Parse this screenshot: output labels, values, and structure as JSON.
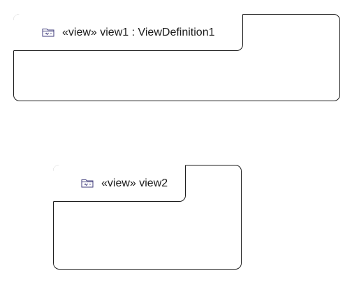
{
  "diagram": {
    "nodes": [
      {
        "id": "view1",
        "icon": "view-icon",
        "label": "«view» view1 : ViewDefinition1"
      },
      {
        "id": "view2",
        "icon": "view-icon",
        "label": "«view» view2"
      }
    ],
    "colors": {
      "border": "#1c1c1c",
      "icon_stroke": "#3d3a7a",
      "text": "#1a1a1a",
      "background": "#ffffff"
    }
  }
}
